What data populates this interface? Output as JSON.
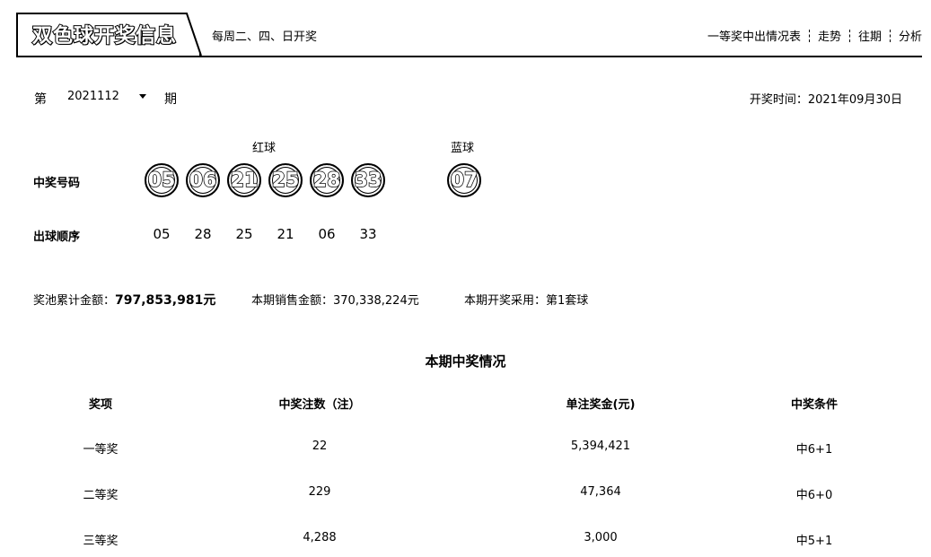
{
  "header": {
    "logo_text": "双色球开奖信息",
    "schedule": "每周二、四、日开奖",
    "nav": [
      "一等奖中出情况表",
      "走势",
      "往期",
      "分析"
    ]
  },
  "period": {
    "prefix": "第",
    "value": "2021112",
    "suffix": "期",
    "draw_time": "开奖时间：2021年09月30日"
  },
  "balls": {
    "red_label": "红球",
    "blue_label": "蓝球",
    "winning_label": "中奖号码",
    "order_label": "出球顺序",
    "red": [
      "05",
      "06",
      "21",
      "25",
      "28",
      "33"
    ],
    "blue": "07",
    "order": [
      "05",
      "28",
      "25",
      "21",
      "06",
      "33"
    ]
  },
  "pool": {
    "pool_label": "奖池累计金额：",
    "pool_value": "797,853,981元",
    "sales_label": "本期销售金额：",
    "sales_value": "370,338,224元",
    "balls_label": "本期开奖采用：",
    "balls_value": "第1套球"
  },
  "prize_table": {
    "title": "本期中奖情况",
    "headers": [
      "奖项",
      "中奖注数（注）",
      "单注奖金(元)",
      "中奖条件"
    ],
    "rows": [
      [
        "一等奖",
        "22",
        "5,394,421",
        "中6+1"
      ],
      [
        "二等奖",
        "229",
        "47,364",
        "中6+0"
      ],
      [
        "三等奖",
        "4,288",
        "3,000",
        "中5+1"
      ]
    ]
  }
}
